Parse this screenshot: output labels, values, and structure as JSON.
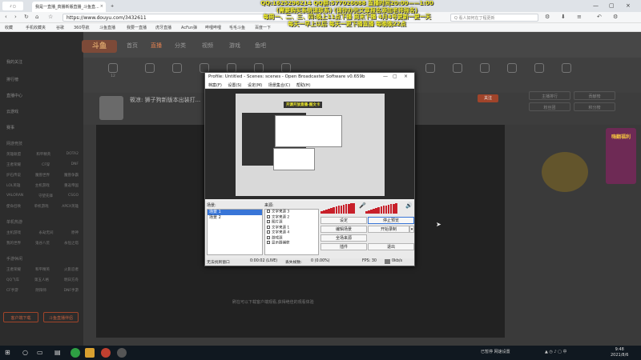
{
  "browser": {
    "tabs": [
      {
        "label": "我是一直播_真播新版直播_斗鱼直...",
        "icon": "douyu-icon"
      },
      {
        "label": "",
        "icon": "plus-icon"
      }
    ],
    "url": "https://www.douyu.com/3432611",
    "search_placeholder": "Q 看人如何在丁程更新",
    "bookmarks": [
      "收藏",
      "手机收藏夹",
      "谷歌",
      "手机收藏夹",
      "360导航",
      "斗鱼直播",
      "我要一直播",
      "我要一直播",
      "虎牙直播",
      "AcFun弹",
      "哔哩哔哩",
      "毛毛斗鱼",
      "百度一下"
    ]
  },
  "overlay": {
    "lines": [
      "QQ:1625296214   QQ群:577026088   直播时间20:00——1:00",
      "(需要购买系统请联系)   (请你办完文章报名添加老师报名)",
      "每周一、二、三、四:晚上11点下播 周末下播   4月4号更新一更一天",
      "每天一早上以后   每天一更下播直播   每晚晚22点"
    ]
  },
  "site": {
    "logo": "斗鱼",
    "nav": [
      "首页",
      "直播",
      "分类",
      "视频",
      "游戏",
      "鱼吧"
    ],
    "categories": [
      "12",
      "",
      "",
      "",
      "",
      "",
      "",
      "",
      "",
      "",
      "",
      "",
      "",
      "",
      "",
      "",
      "",
      "",
      "",
      ""
    ],
    "room_title": "筱凉: 狮子狗新版本出装打...",
    "follow_label": "关注",
    "player_caption": "刷在可以下载客户端观看,获得绝佳的观看体验",
    "sidebar": {
      "items": [
        "我的关注",
        "排行榜",
        "直播中心",
        "云游戏",
        "赛事"
      ],
      "section1": "网游竞技",
      "games1": [
        "英雄联盟",
        "和平精英",
        "DOTA2",
        "王者荣耀",
        "CF穿",
        "DNF",
        "炉石传说",
        "魔兽世界",
        "魔兽争霸",
        "LOL英雄",
        "主机游戏",
        "重返帝国",
        "VALORAN",
        "守望先锋",
        "CSGO",
        "使命召唤",
        "单机游戏",
        "APEX英雄"
      ],
      "section2": "单机热游",
      "games2": [
        "主机游戏",
        "永劫无间",
        "原神",
        "我的世界",
        "鬼谷八荒",
        "永恒之塔"
      ],
      "section3": "手游休闲",
      "games3": [
        "王者荣耀",
        "和平精英",
        "火影忍者",
        "QQ飞车",
        "第五人格",
        "明日方舟",
        "CF手游",
        "阴阳师",
        "DNF手游"
      ],
      "btn1": "客户端下载",
      "btn2": "斗鱼直播伴侣"
    },
    "right_buttons": [
      "主播排行",
      "贡献榜",
      "粉丝团",
      "积分榜"
    ],
    "promo": "嗨翻福利"
  },
  "obs": {
    "title": "Profile: Untitled - Scenes: scenes - Open Broadcaster Software v0.659b",
    "menu": [
      "档案(F)",
      "设置(S)",
      "设定(M)",
      "场景集合(C)",
      "帮助(H)"
    ],
    "preview_caption": "开源开放直播-图文卡",
    "scenes_label": "场景:",
    "scenes": [
      "场景 1",
      "场景 2"
    ],
    "sources_label": "来源:",
    "sources": [
      "文字来源 3",
      "文字来源 2",
      "图片源",
      "文字来源 1",
      "文字来源 4",
      "游戏源",
      "显示器捕获"
    ],
    "buttons": [
      "设定",
      "停止预览",
      "编辑场景",
      "开始录制",
      "全场来源",
      "",
      "插件",
      "退出"
    ],
    "status": [
      "无法找到窗口",
      "0:00:02 (LIVE)",
      "丢失帧数:",
      "0 (0.00%)",
      "FPS: 30",
      "0kb/s"
    ]
  },
  "taskbar": {
    "tray": "已暂停  网速设置",
    "time": "9:48",
    "date": "2021/8/6"
  }
}
